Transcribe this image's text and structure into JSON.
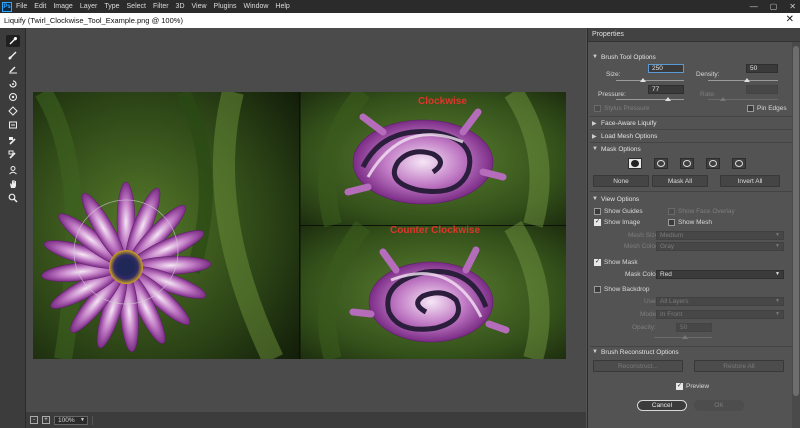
{
  "app": {
    "logo": "Ps",
    "menu": [
      "File",
      "Edit",
      "Image",
      "Layer",
      "Type",
      "Select",
      "Filter",
      "3D",
      "View",
      "Plugins",
      "Window",
      "Help"
    ],
    "window_controls": [
      "—",
      "▢",
      "✕"
    ]
  },
  "dialog": {
    "title": "Liquify (Twirl_Clockwise_Tool_Example.png @ 100%)",
    "close_glyph": "✕"
  },
  "tools": [
    "forward-warp",
    "reconstruct",
    "smooth",
    "twirl-clockwise",
    "pucker",
    "bloat",
    "push-left",
    "freeze-mask",
    "thaw-mask",
    "face",
    "hand",
    "zoom"
  ],
  "canvas": {
    "overlay_top": "Clockwise",
    "overlay_bottom": "Counter Clockwise",
    "overlay_color": "#e0352b"
  },
  "status": {
    "zoom": "100%",
    "minus": "-",
    "plus": "+"
  },
  "properties": {
    "title": "Properties",
    "brush_tool_options": {
      "header": "Brush Tool Options",
      "size_label": "Size:",
      "size_value": "250",
      "density_label": "Density:",
      "density_value": "50",
      "pressure_label": "Pressure:",
      "pressure_value": "77",
      "rate_label": "Rate:",
      "rate_value": "",
      "stylus_pressure": "Stylus Pressure",
      "pin_edges": "Pin Edges"
    },
    "face_aware_liquify": "Face-Aware Liquify",
    "load_mesh_options": "Load Mesh Options",
    "mask_options": {
      "header": "Mask Options",
      "none": "None",
      "mask_all": "Mask All",
      "invert_all": "Invert All"
    },
    "view_options": {
      "header": "View Options",
      "show_guides": "Show Guides",
      "show_face_overlay": "Show Face Overlay",
      "show_image": "Show Image",
      "show_mesh": "Show Mesh",
      "mesh_size_label": "Mesh Size:",
      "mesh_size_value": "Medium",
      "mesh_color_label": "Mesh Color:",
      "mesh_color_value": "Gray",
      "show_mask": "Show Mask",
      "mask_color_label": "Mask Color:",
      "mask_color_value": "Red",
      "show_backdrop": "Show Backdrop",
      "use_label": "Use:",
      "use_value": "All Layers",
      "mode_label": "Mode:",
      "mode_value": "In Front",
      "opacity_label": "Opacity:",
      "opacity_value": "50"
    },
    "brush_reconstruct_options": {
      "header": "Brush Reconstruct Options",
      "reconstruct": "Reconstruct...",
      "restore_all": "Restore All"
    },
    "preview": "Preview",
    "cancel": "Cancel",
    "ok": "OK"
  }
}
